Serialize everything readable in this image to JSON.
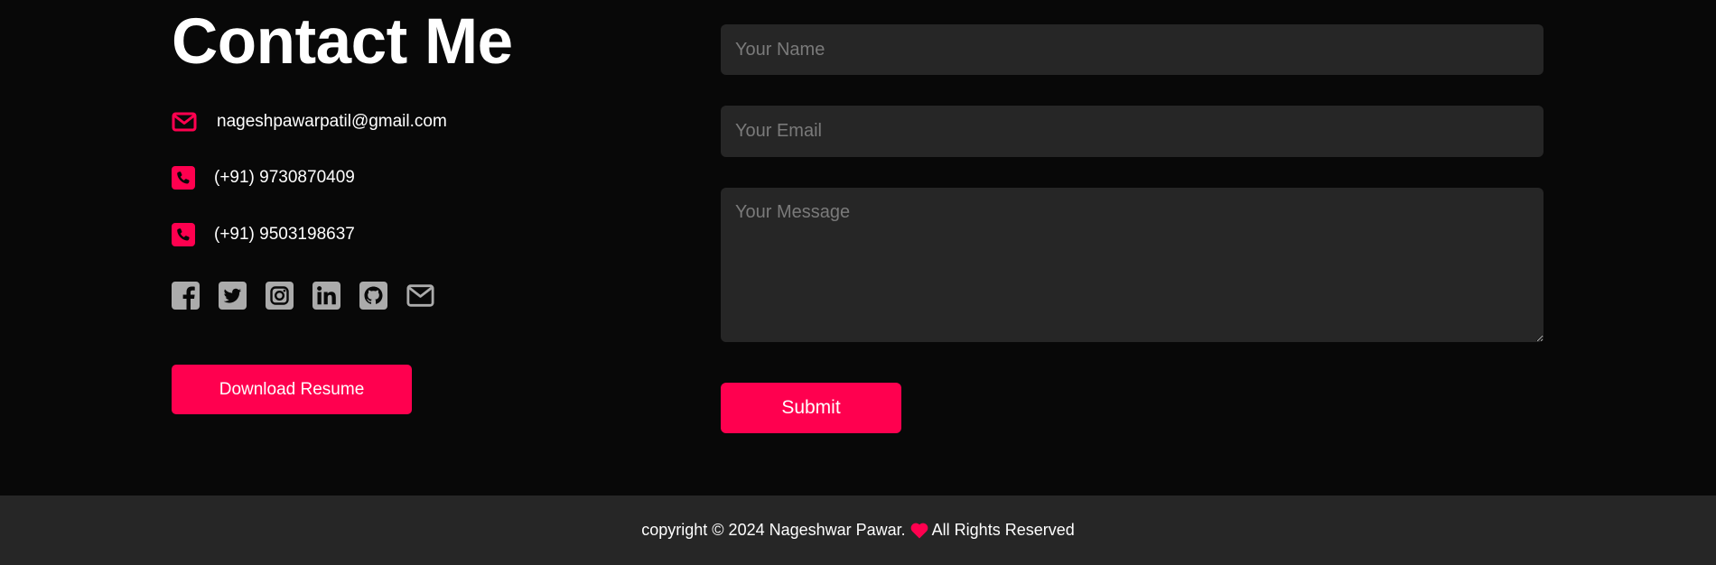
{
  "contact": {
    "title": "Contact Me",
    "email": "nageshpawarpatil@gmail.com",
    "phones": [
      "(+91) 9730870409",
      "(+91) 9503198637"
    ],
    "email_icon": "envelope-icon",
    "phone_icon": "phone-square-icon"
  },
  "socials": [
    {
      "icon": "facebook-icon"
    },
    {
      "icon": "twitter-icon"
    },
    {
      "icon": "instagram-icon"
    },
    {
      "icon": "linkedin-icon"
    },
    {
      "icon": "github-icon"
    },
    {
      "icon": "envelope-icon"
    }
  ],
  "resume_button": "Download Resume",
  "form": {
    "name_placeholder": "Your Name",
    "email_placeholder": "Your Email",
    "message_placeholder": "Your Message",
    "submit_label": "Submit"
  },
  "footer": {
    "text_before": "copyright © 2024 Nageshwar Pawar.",
    "text_after": "All Rights Reserved",
    "heart_icon": "heart-icon"
  },
  "colors": {
    "background": "#080808",
    "accent": "#ff004f",
    "input_bg": "#262626",
    "footer_bg": "#262626",
    "social_icon": "#ababab",
    "text": "#ffffff",
    "placeholder": "#7a7a7a"
  }
}
